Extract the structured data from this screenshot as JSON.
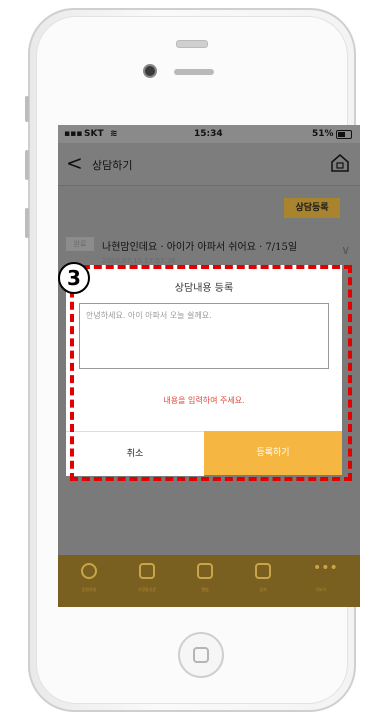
{
  "status_bar": {
    "carrier": "SKT",
    "time": "15:34",
    "battery": "51%"
  },
  "header": {
    "title": "상담하기"
  },
  "consult_button": "상담등록",
  "list_item": {
    "badge": "완료",
    "title": "나현맘인데요 · 아이가 아파서 쉬어요 · 7/15일",
    "date": "2020.07.15 17:57:36"
  },
  "modal": {
    "title": "상담내용 등록",
    "textarea_placeholder": "안녕하세요. 아이 아파서 오늘 쉴께요.",
    "warning": "내용을 입력하여 주세요.",
    "cancel_label": "취소",
    "submit_label": "등록하기"
  },
  "tab_bar": [
    {
      "label": "등원하원",
      "icon": "clock-icon"
    },
    {
      "label": "가정통신문",
      "icon": "document-icon"
    },
    {
      "label": "앨범",
      "icon": "photo-icon"
    },
    {
      "label": "공지",
      "icon": "notice-icon"
    },
    {
      "label": "더보기",
      "icon": "more-icon"
    }
  ],
  "annotation": {
    "step": "3"
  },
  "colors": {
    "accent": "#f5b741",
    "warning": "#e0463a",
    "annotation": "#e10000"
  }
}
